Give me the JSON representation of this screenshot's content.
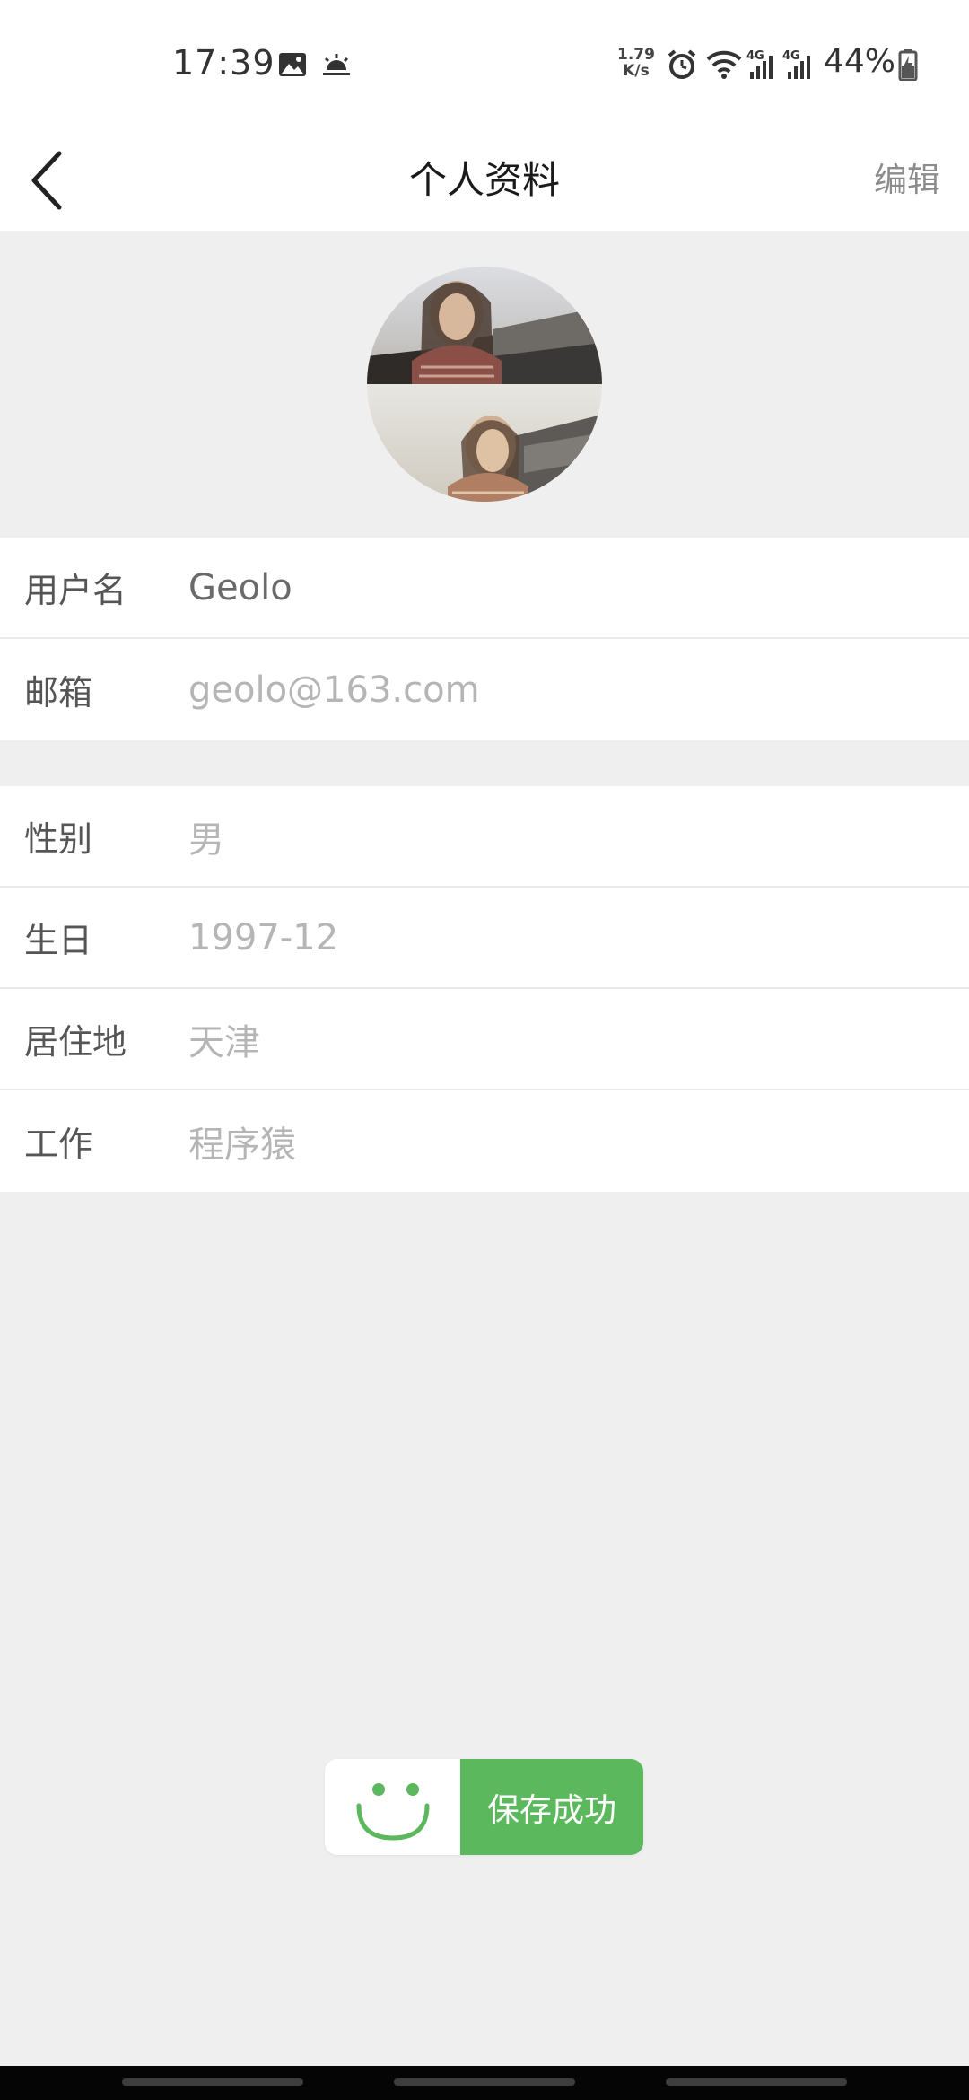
{
  "status_bar": {
    "time": "17:39",
    "net_speed_value": "1.79",
    "net_speed_unit": "K/s",
    "network_1": "4G",
    "network_2": "4G",
    "battery": "44%"
  },
  "header": {
    "title": "个人资料",
    "edit_label": "编辑"
  },
  "profile_group": [
    {
      "label": "用户名",
      "value": "Geolo"
    },
    {
      "label": "邮箱",
      "value": "geolo@163.com"
    }
  ],
  "details_group": [
    {
      "label": "性别",
      "value": "男"
    },
    {
      "label": "生日",
      "value": "1997-12"
    },
    {
      "label": "居住地",
      "value": "天津"
    },
    {
      "label": "工作",
      "value": "程序猿"
    }
  ],
  "toast": {
    "message": "保存成功"
  },
  "colors": {
    "accent_green": "#5cb85c",
    "page_bg": "#efefef",
    "muted_text": "#b5b5b5"
  },
  "icons": [
    "back-arrow-icon",
    "smile-icon",
    "image-icon",
    "weather-icon",
    "alarm-icon",
    "wifi-icon",
    "signal-icon",
    "battery-icon"
  ]
}
